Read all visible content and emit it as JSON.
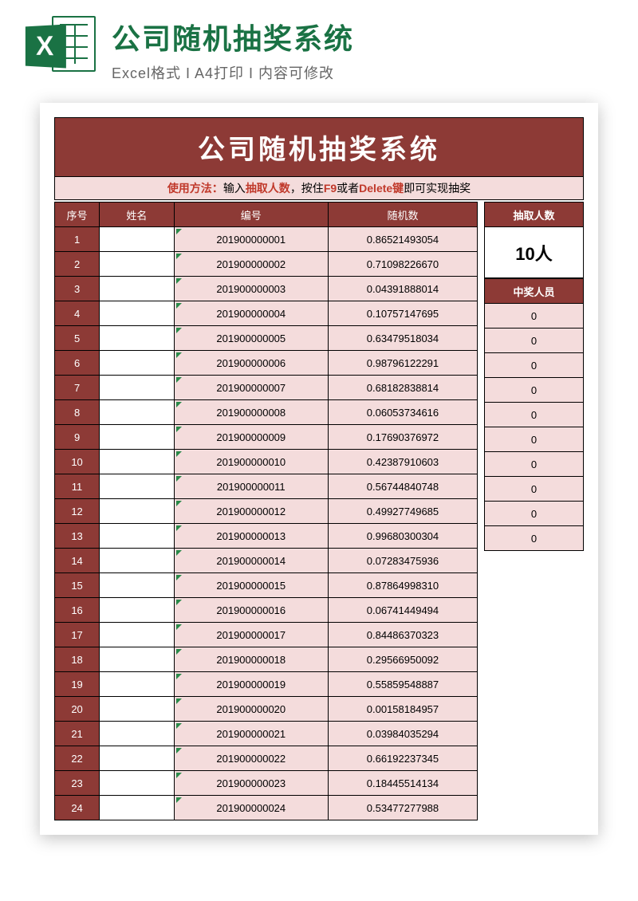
{
  "header": {
    "title": "公司随机抽奖系统",
    "subtitle": "Excel格式 I A4打印 I 内容可修改",
    "icon_letter": "X"
  },
  "doc": {
    "title": "公司随机抽奖系统",
    "instruction": {
      "prefix": "使用方法：",
      "t1": "输入",
      "red1": "抽取人数",
      "t2": "，按住",
      "red2": "F9",
      "t3": "或者",
      "red3": "Delete键",
      "t4": "即可实现抽奖"
    },
    "columns": {
      "seq": "序号",
      "name": "姓名",
      "code": "编号",
      "rand": "随机数"
    },
    "rows": [
      {
        "seq": "1",
        "name": "",
        "code": "201900000001",
        "rand": "0.86521493054"
      },
      {
        "seq": "2",
        "name": "",
        "code": "201900000002",
        "rand": "0.71098226670"
      },
      {
        "seq": "3",
        "name": "",
        "code": "201900000003",
        "rand": "0.04391888014"
      },
      {
        "seq": "4",
        "name": "",
        "code": "201900000004",
        "rand": "0.10757147695"
      },
      {
        "seq": "5",
        "name": "",
        "code": "201900000005",
        "rand": "0.63479518034"
      },
      {
        "seq": "6",
        "name": "",
        "code": "201900000006",
        "rand": "0.98796122291"
      },
      {
        "seq": "7",
        "name": "",
        "code": "201900000007",
        "rand": "0.68182838814"
      },
      {
        "seq": "8",
        "name": "",
        "code": "201900000008",
        "rand": "0.06053734616"
      },
      {
        "seq": "9",
        "name": "",
        "code": "201900000009",
        "rand": "0.17690376972"
      },
      {
        "seq": "10",
        "name": "",
        "code": "201900000010",
        "rand": "0.42387910603"
      },
      {
        "seq": "11",
        "name": "",
        "code": "201900000011",
        "rand": "0.56744840748"
      },
      {
        "seq": "12",
        "name": "",
        "code": "201900000012",
        "rand": "0.49927749685"
      },
      {
        "seq": "13",
        "name": "",
        "code": "201900000013",
        "rand": "0.99680300304"
      },
      {
        "seq": "14",
        "name": "",
        "code": "201900000014",
        "rand": "0.07283475936"
      },
      {
        "seq": "15",
        "name": "",
        "code": "201900000015",
        "rand": "0.87864998310"
      },
      {
        "seq": "16",
        "name": "",
        "code": "201900000016",
        "rand": "0.06741449494"
      },
      {
        "seq": "17",
        "name": "",
        "code": "201900000017",
        "rand": "0.84486370323"
      },
      {
        "seq": "18",
        "name": "",
        "code": "201900000018",
        "rand": "0.29566950092"
      },
      {
        "seq": "19",
        "name": "",
        "code": "201900000019",
        "rand": "0.55859548887"
      },
      {
        "seq": "20",
        "name": "",
        "code": "201900000020",
        "rand": "0.00158184957"
      },
      {
        "seq": "21",
        "name": "",
        "code": "201900000021",
        "rand": "0.03984035294"
      },
      {
        "seq": "22",
        "name": "",
        "code": "201900000022",
        "rand": "0.66192237345"
      },
      {
        "seq": "23",
        "name": "",
        "code": "201900000023",
        "rand": "0.18445514134"
      },
      {
        "seq": "24",
        "name": "",
        "code": "201900000024",
        "rand": "0.53477277988"
      }
    ],
    "side": {
      "count_header": "抽取人数",
      "count_value": "10人",
      "winner_header": "中奖人员",
      "winners": [
        "0",
        "0",
        "0",
        "0",
        "0",
        "0",
        "0",
        "0",
        "0",
        "0"
      ]
    }
  }
}
